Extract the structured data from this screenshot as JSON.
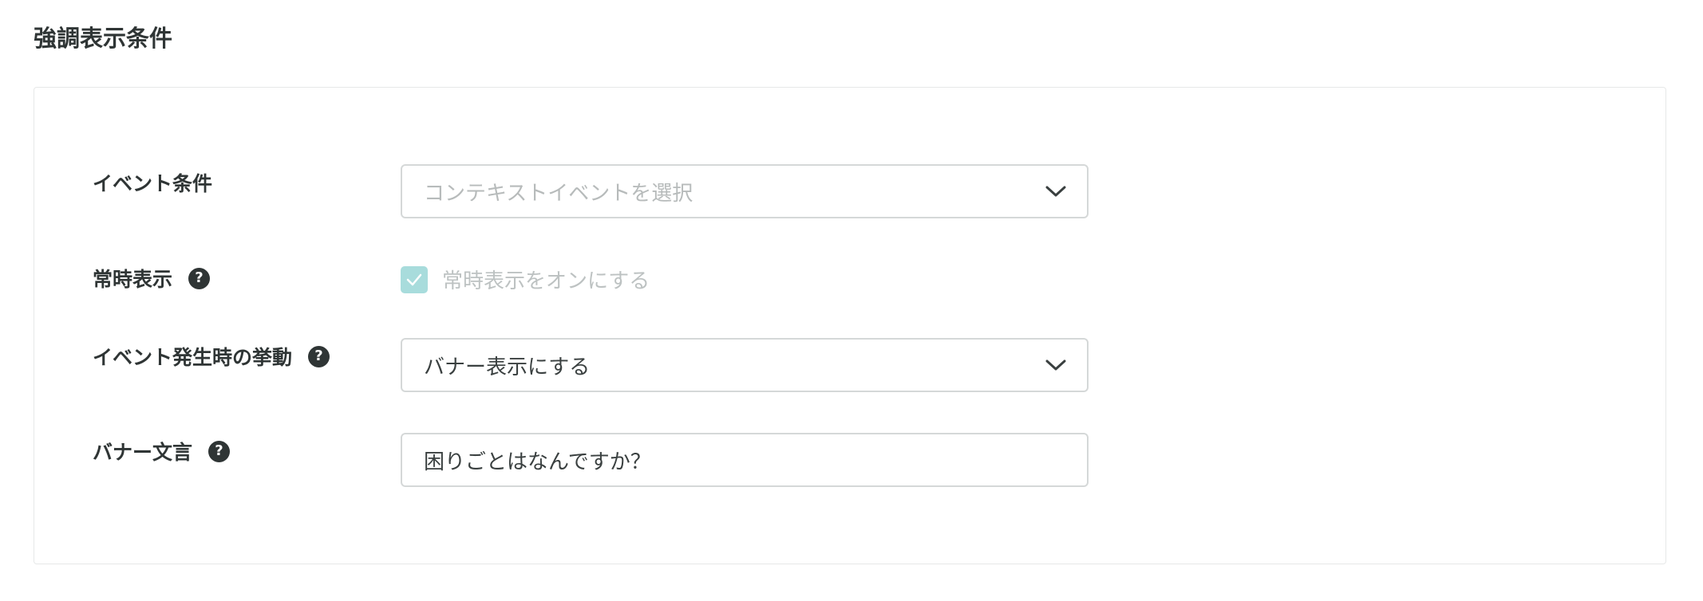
{
  "section": {
    "title": "強調表示条件"
  },
  "form": {
    "event_condition": {
      "label": "イベント条件",
      "placeholder": "コンテキストイベントを選択",
      "value": ""
    },
    "always_display": {
      "label": "常時表示",
      "help_icon": "question-circle-icon",
      "checkbox_label": "常時表示をオンにする",
      "checked": true,
      "disabled": true
    },
    "event_behavior": {
      "label": "イベント発生時の挙動",
      "help_icon": "question-circle-icon",
      "value": "バナー表示にする"
    },
    "banner_text": {
      "label": "バナー文言",
      "help_icon": "question-circle-icon",
      "value": "困りごとはなんですか？"
    }
  },
  "icons": {
    "help": "?"
  },
  "colors": {
    "checkbox_fill": "#a8dcdc",
    "text_dark": "#2f3535",
    "border": "#d5d8d8",
    "placeholder": "#b7bbbb"
  }
}
